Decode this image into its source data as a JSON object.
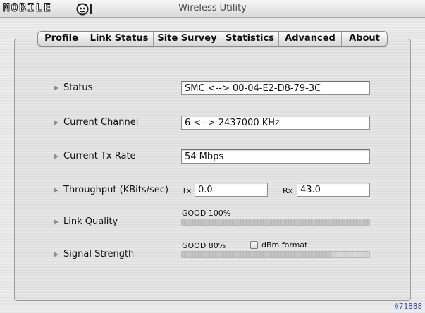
{
  "window": {
    "title": "Wireless Utility",
    "logo_text": "MOBILE",
    "logo_icon": "robot-face-logo"
  },
  "tabs": [
    {
      "label": "Profile"
    },
    {
      "label": "Link Status"
    },
    {
      "label": "Site Survey"
    },
    {
      "label": "Statistics"
    },
    {
      "label": "Advanced"
    },
    {
      "label": "About"
    }
  ],
  "link_status": {
    "status": {
      "label": "Status",
      "value": "SMC <--> 00-04-E2-D8-79-3C"
    },
    "channel": {
      "label": "Current Channel",
      "value": "6 <--> 2437000 KHz"
    },
    "tx_rate": {
      "label": "Current Tx Rate",
      "value": "54 Mbps"
    },
    "throughput": {
      "label": "Throughput (KBits/sec)",
      "tx_label": "Tx",
      "tx_value": "0.0",
      "rx_label": "Rx",
      "rx_value": "43.0"
    },
    "link_quality": {
      "label": "Link Quality",
      "text": "GOOD 100%",
      "percent": 100
    },
    "signal_strength": {
      "label": "Signal Strength",
      "text": "GOOD 80%",
      "percent": 80,
      "dbm_label": "dBm format",
      "dbm_checked": false
    }
  },
  "watermark": "#71888",
  "colors": {
    "watermark": "#3a4fb0",
    "triangle": "#8c8c8c"
  }
}
